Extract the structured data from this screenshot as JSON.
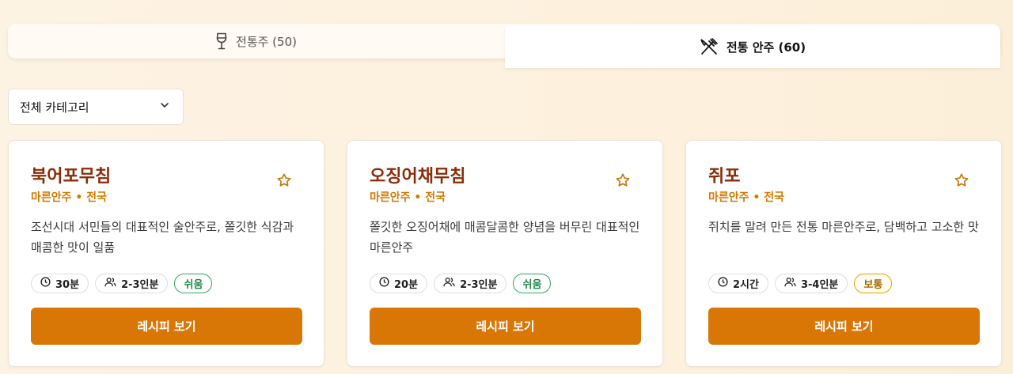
{
  "tabs": [
    {
      "label": "전통주 (50)",
      "icon": "wine-glass-icon",
      "active": false
    },
    {
      "label": "전통 안주 (60)",
      "icon": "fork-knife-icon",
      "active": true
    }
  ],
  "filter": {
    "selected": "전체 카테고리"
  },
  "cards": [
    {
      "title": "북어포무침",
      "meta": "마른안주 • 전국",
      "description": "조선시대 서민들의 대표적인 술안주로, 쫄깃한 식감과 매콤한 맛이 일품",
      "time": "30분",
      "servings": "2-3인분",
      "difficulty": "쉬움",
      "button": "레시피 보기"
    },
    {
      "title": "오징어채무침",
      "meta": "마른안주 • 전국",
      "description": "쫄깃한 오징어채에 매콤달콤한 양념을 버무린 대표적인 마른안주",
      "time": "20분",
      "servings": "2-3인분",
      "difficulty": "쉬움",
      "button": "레시피 보기"
    },
    {
      "title": "쥐포",
      "meta": "마른안주 • 전국",
      "description": "쥐치를 말려 만든 전통 마른안주로, 담백하고 고소한 맛",
      "time": "2시간",
      "servings": "3-4인분",
      "difficulty": "보통",
      "button": "레시피 보기"
    }
  ],
  "colors": {
    "accent": "#d97706",
    "title": "#8a2c08",
    "meta": "#d17a00",
    "easy": "#2fa75a",
    "normal": "#e0a500"
  }
}
